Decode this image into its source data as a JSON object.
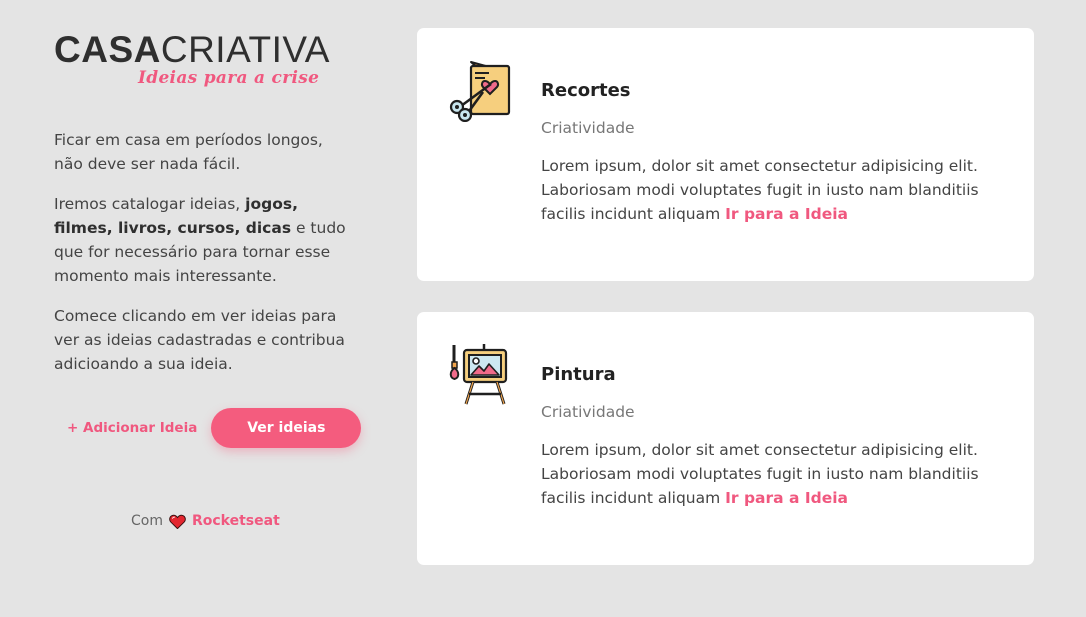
{
  "brand": {
    "name_bold": "CASA",
    "name_light": "CRIATIVA",
    "tagline": "Ideias para a crise"
  },
  "intro": {
    "p1": "Ficar em casa em períodos longos, não deve ser nada fácil.",
    "p2_before": "Iremos catalogar ideias, ",
    "p2_bold": "jogos, filmes, livros, cursos, dicas",
    "p2_after": " e tudo que for necessário para tornar esse momento mais interessante.",
    "p3": "Comece clicando em ver ideias para ver as ideias cadastradas e contribua adicioando a sua ideia."
  },
  "actions": {
    "add_label": "+ Adicionar Ideia",
    "see_label": "Ver ideias"
  },
  "credits": {
    "prefix": "Com",
    "link": "Rocketseat"
  },
  "ideas": [
    {
      "title": "Recortes",
      "category": "Criatividade",
      "description": "Lorem ipsum, dolor sit amet consectetur adipisicing elit. Laboriosam modi voluptates fugit in iusto nam blanditiis facilis incidunt aliquam",
      "link": "Ir para a Ideia",
      "icon": "scissors-card-icon"
    },
    {
      "title": "Pintura",
      "category": "Criatividade",
      "description": "Lorem ipsum, dolor sit amet consectetur adipisicing elit. Laboriosam modi voluptates fugit in iusto nam blanditiis facilis incidunt aliquam",
      "link": "Ir para a Ideia",
      "icon": "easel-painting-icon"
    }
  ],
  "colors": {
    "accent": "#f45c7e",
    "background": "#e4e4e4",
    "card": "#ffffff"
  }
}
